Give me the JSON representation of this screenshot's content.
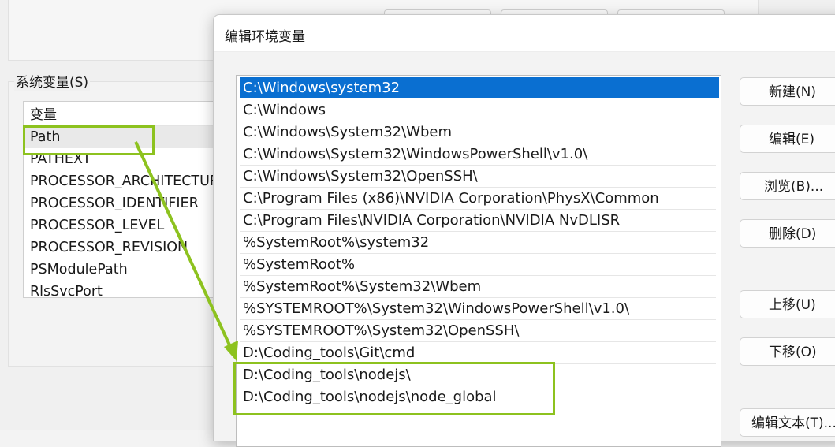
{
  "parent_window": {
    "group_label": "系统变量(S)",
    "list_header": "变量",
    "variables": [
      "Path",
      "PATHEXT",
      "PROCESSOR_ARCHITECTURE",
      "PROCESSOR_IDENTIFIER",
      "PROCESSOR_LEVEL",
      "PROCESSOR_REVISION",
      "PSModulePath",
      "RlsSvcPort"
    ],
    "selected_variable": "Path"
  },
  "dialog": {
    "title": "编辑环境变量",
    "paths": [
      "C:\\Windows\\system32",
      "C:\\Windows",
      "C:\\Windows\\System32\\Wbem",
      "C:\\Windows\\System32\\WindowsPowerShell\\v1.0\\",
      "C:\\Windows\\System32\\OpenSSH\\",
      "C:\\Program Files (x86)\\NVIDIA Corporation\\PhysX\\Common",
      "C:\\Program Files\\NVIDIA Corporation\\NVIDIA NvDLISR",
      "%SystemRoot%\\system32",
      "%SystemRoot%",
      "%SystemRoot%\\System32\\Wbem",
      "%SYSTEMROOT%\\System32\\WindowsPowerShell\\v1.0\\",
      "%SYSTEMROOT%\\System32\\OpenSSH\\",
      "D:\\Coding_tools\\Git\\cmd",
      "D:\\Coding_tools\\nodejs\\",
      "D:\\Coding_tools\\nodejs\\node_global"
    ],
    "selected_index": 0,
    "buttons": {
      "new": "新建(N)",
      "edit": "编辑(E)",
      "browse": "浏览(B)...",
      "delete": "删除(D)",
      "move_up": "上移(U)",
      "move_down": "下移(O)",
      "edit_text": "编辑文本(T)..."
    }
  },
  "colors": {
    "selection": "#0a6fd1",
    "annotation": "#8dc21f"
  }
}
